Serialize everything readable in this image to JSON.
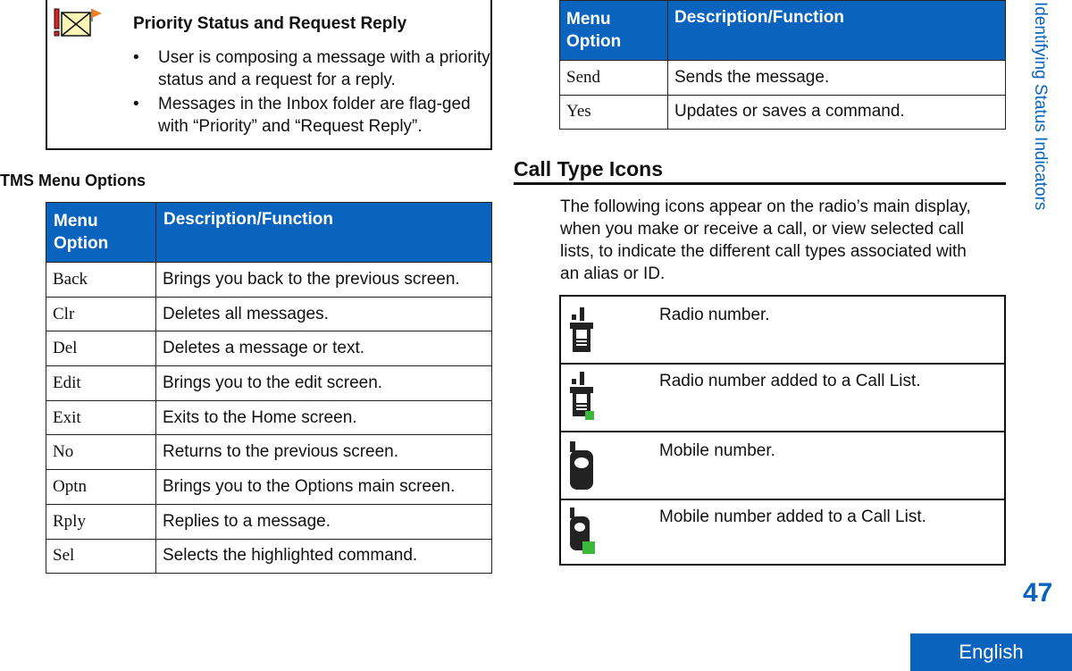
{
  "note_box": {
    "title": "Priority Status and Request Reply",
    "bullets": [
      "User is composing a message with a priority status and a request for a reply.",
      "Messages in the Inbox folder are flag-ged with “Priority” and “Request Reply”."
    ],
    "icon": "priority-request-reply-icon"
  },
  "tms_section": {
    "title": "TMS Menu Options",
    "header": [
      "Menu Option",
      "Description/Function"
    ],
    "rows": [
      {
        "option": "Back",
        "desc": "Brings you back to the previous screen."
      },
      {
        "option": "Clr",
        "desc": "Deletes all messages."
      },
      {
        "option": "Del",
        "desc": "Deletes a message or text."
      },
      {
        "option": "Edit",
        "desc": "Brings you to the edit screen."
      },
      {
        "option": "Exit",
        "desc": "Exits to the Home screen."
      },
      {
        "option": "No",
        "desc": "Returns to the previous screen."
      },
      {
        "option": "Optn",
        "desc": "Brings you to the Options main screen."
      },
      {
        "option": "Rply",
        "desc": "Replies to a message."
      },
      {
        "option": "Sel",
        "desc": "Selects the highlighted command."
      }
    ]
  },
  "right_table": {
    "header": [
      "Menu Option",
      "Description/Function"
    ],
    "rows": [
      {
        "option": "Send",
        "desc": "Sends the message."
      },
      {
        "option": "Yes",
        "desc": "Updates or saves a command."
      }
    ]
  },
  "call_type": {
    "title": "Call Type Icons",
    "intro": "The following icons appear on the radio’s main display, when you make or receive a call, or view selected call lists, to indicate the different call types associated with an alias or ID.",
    "rows": [
      {
        "icon": "radio-icon",
        "desc": "Radio number."
      },
      {
        "icon": "radio-call-list-icon",
        "desc": "Radio number added to a Call List."
      },
      {
        "icon": "mobile-icon",
        "desc": "Mobile number."
      },
      {
        "icon": "mobile-call-list-icon",
        "desc": "Mobile number added to a Call List."
      }
    ]
  },
  "side_tab": "Identifying Status Indicators",
  "page_number": "47",
  "language": "English",
  "colors": {
    "accent": "#0a64be",
    "green": "#3cb93c"
  }
}
